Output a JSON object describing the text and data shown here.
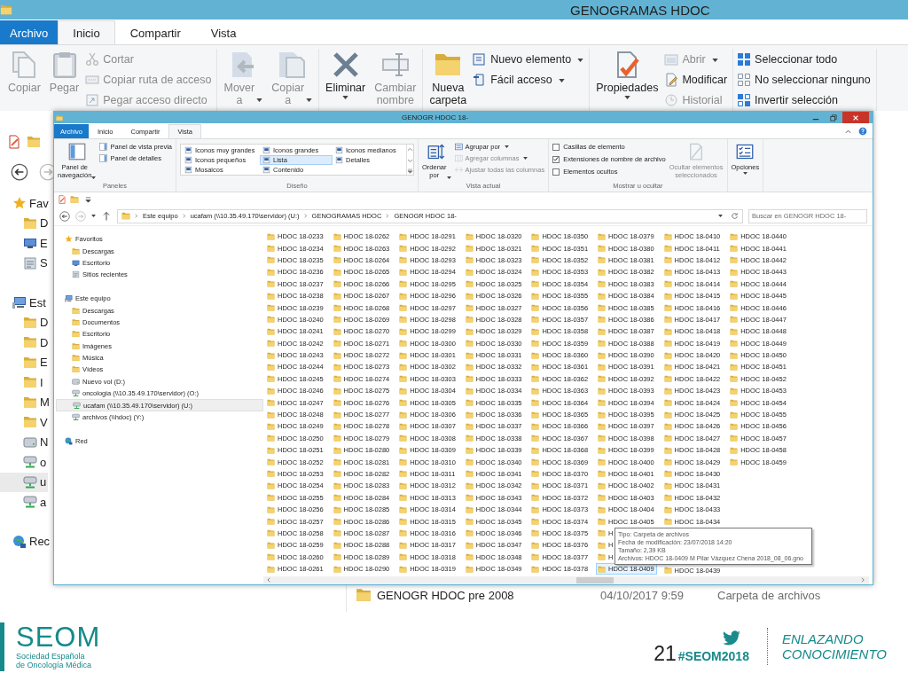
{
  "back_window": {
    "title": "GENOGRAMAS HDOC",
    "tabs": [
      {
        "label": "Archivo",
        "kind": "file",
        "selected": false
      },
      {
        "label": "Inicio",
        "kind": "tab",
        "selected": true
      },
      {
        "label": "Compartir",
        "kind": "tab",
        "selected": false
      },
      {
        "label": "Vista",
        "kind": "tab",
        "selected": false
      }
    ],
    "ribbon": [
      {
        "items": [
          {
            "kind": "large",
            "label": "Copiar",
            "dropdown": false,
            "disabled": true
          },
          {
            "kind": "large",
            "label": "Pegar",
            "dropdown": false,
            "disabled": true
          },
          {
            "kind": "small",
            "label": "Cortar",
            "dropdown": false,
            "disabled": true
          },
          {
            "kind": "small",
            "label": "Copiar ruta de acceso",
            "dropdown": false,
            "disabled": true
          },
          {
            "kind": "small",
            "label": "Pegar acceso directo",
            "dropdown": false,
            "disabled": true
          }
        ]
      },
      {
        "items": [
          {
            "kind": "large",
            "label": "Mover\na",
            "dropdown": true,
            "disabled": true
          },
          {
            "kind": "large",
            "label": "Copiar\na",
            "dropdown": true,
            "disabled": true
          }
        ]
      },
      {
        "items": [
          {
            "kind": "large",
            "label": "Eliminar",
            "dropdown": true,
            "disabled": false
          },
          {
            "kind": "large",
            "label": "Cambiar\nnombre",
            "dropdown": false,
            "disabled": true
          }
        ]
      },
      {
        "items": [
          {
            "kind": "large",
            "label": "Nueva\ncarpeta",
            "dropdown": false,
            "disabled": false
          },
          {
            "kind": "small",
            "label": "Nuevo elemento",
            "dropdown": true,
            "disabled": false
          },
          {
            "kind": "small",
            "label": "Fácil acceso",
            "dropdown": true,
            "disabled": false
          }
        ]
      },
      {
        "items": [
          {
            "kind": "large",
            "label": "Propiedades",
            "dropdown": true,
            "disabled": false
          },
          {
            "kind": "small",
            "label": "Abrir",
            "dropdown": true,
            "disabled": true
          },
          {
            "kind": "small",
            "label": "Modificar",
            "dropdown": false,
            "disabled": false
          },
          {
            "kind": "small",
            "label": "Historial",
            "dropdown": false,
            "disabled": true
          }
        ]
      },
      {
        "items": [
          {
            "kind": "small",
            "label": "Seleccionar todo",
            "dropdown": false,
            "disabled": false
          },
          {
            "kind": "small",
            "label": "No seleccionar ninguno",
            "dropdown": false,
            "disabled": false
          },
          {
            "kind": "small",
            "label": "Invertir selección",
            "dropdown": false,
            "disabled": false
          }
        ]
      }
    ],
    "nav": [
      {
        "label": "Fav",
        "selected": false,
        "children": [
          {
            "label": "D",
            "selected": false
          },
          {
            "label": "E",
            "selected": false
          },
          {
            "label": "S",
            "selected": false
          }
        ]
      },
      {
        "label": "Est",
        "selected": false,
        "children": [
          {
            "label": "D",
            "selected": false
          },
          {
            "label": "D",
            "selected": false
          },
          {
            "label": "E",
            "selected": false
          },
          {
            "label": "I",
            "selected": false
          },
          {
            "label": "M",
            "selected": false
          },
          {
            "label": "V",
            "selected": false
          },
          {
            "label": "N",
            "selected": false
          },
          {
            "label": "o",
            "selected": false
          },
          {
            "label": "u",
            "selected": true
          },
          {
            "label": "a",
            "selected": false
          }
        ]
      },
      {
        "label": "Rec",
        "selected": false
      }
    ],
    "file_row": {
      "name": "GENOGR HDOC pre 2008",
      "date": "04/10/2017 9:59",
      "type": "Carpeta de archivos"
    }
  },
  "front_window": {
    "title": "GENOGR HDOC 18-",
    "tabs": [
      {
        "label": "Archivo",
        "kind": "file",
        "selected": false
      },
      {
        "label": "Inicio",
        "kind": "tab",
        "selected": false
      },
      {
        "label": "Compartir",
        "kind": "tab",
        "selected": false
      },
      {
        "label": "Vista",
        "kind": "tab",
        "selected": true
      }
    ],
    "ribbon": [
      {
        "label": "Paneles",
        "items": [
          {
            "kind": "large",
            "label": "Panel de\nnavegación",
            "dropdown": true,
            "disabled": false
          },
          {
            "kind": "small",
            "label": "Panel de vista previa",
            "dropdown": false,
            "disabled": false
          },
          {
            "kind": "small",
            "label": "Panel de detalles",
            "dropdown": false,
            "disabled": false
          }
        ]
      },
      {
        "label": "Diseño",
        "items": [
          {
            "kind": "layout",
            "label": "Iconos muy grandes",
            "selected": false
          },
          {
            "kind": "layout",
            "label": "Iconos grandes",
            "selected": false
          },
          {
            "kind": "layout",
            "label": "Iconos medianos",
            "selected": false
          },
          {
            "kind": "layout",
            "label": "Iconos pequeños",
            "selected": false
          },
          {
            "kind": "layout",
            "label": "Lista",
            "selected": true
          },
          {
            "kind": "layout",
            "label": "Detalles",
            "selected": false
          },
          {
            "kind": "layout",
            "label": "Mosaicos",
            "selected": false
          },
          {
            "kind": "layout",
            "label": "Contenido",
            "selected": false
          }
        ]
      },
      {
        "label": "Vista actual",
        "items": [
          {
            "kind": "large",
            "label": "Ordenar\npor",
            "dropdown": true,
            "disabled": false
          },
          {
            "kind": "small",
            "label": "Agrupar por",
            "dropdown": true,
            "disabled": false
          },
          {
            "kind": "small",
            "label": "Agregar columnas",
            "dropdown": true,
            "disabled": true
          },
          {
            "kind": "small",
            "label": "Ajustar todas las columnas",
            "dropdown": false,
            "disabled": true
          }
        ]
      },
      {
        "label": "Mostrar u ocultar",
        "items": [
          {
            "kind": "check",
            "label": "Casillas de elemento",
            "checked": false
          },
          {
            "kind": "check",
            "label": "Extensiones de nombre de archivo",
            "checked": true
          },
          {
            "kind": "check",
            "label": "Elementos ocultos",
            "checked": false
          },
          {
            "kind": "large",
            "label": "Ocultar elementos\nseleccionados",
            "dropdown": false,
            "disabled": true
          }
        ]
      },
      {
        "items": [
          {
            "kind": "large",
            "label": "Opciones",
            "dropdown": true,
            "disabled": false
          }
        ]
      }
    ],
    "address": {
      "path": [
        "Este equipo",
        "ucafam (\\\\10.35.49.170\\servidor) (U:)",
        "GENOGRAMAS HDOC",
        "GENOGR HDOC 18-"
      ],
      "search_placeholder": "Buscar en GENOGR HDOC 18-"
    },
    "nav": [
      {
        "label": "Favoritos",
        "selected": false,
        "children": [
          {
            "label": "Descargas",
            "selected": false
          },
          {
            "label": "Escritorio",
            "selected": false
          },
          {
            "label": "Sitios recientes",
            "selected": false
          }
        ]
      },
      {
        "label": "Este equipo",
        "selected": false,
        "children": [
          {
            "label": "Descargas",
            "selected": false
          },
          {
            "label": "Documentos",
            "selected": false
          },
          {
            "label": "Escritorio",
            "selected": false
          },
          {
            "label": "Imágenes",
            "selected": false
          },
          {
            "label": "Música",
            "selected": false
          },
          {
            "label": "Vídeos",
            "selected": false
          },
          {
            "label": "Nuevo vol (D:)",
            "selected": false
          },
          {
            "label": "oncologia (\\\\10.35.49.170\\servidor) (O:)",
            "selected": false
          },
          {
            "label": "ucafam (\\\\10.35.49.170\\servidor) (U:)",
            "selected": true
          },
          {
            "label": "archivos (\\\\hdoc) (Y:)",
            "selected": false
          }
        ]
      },
      {
        "label": "Red",
        "selected": false
      }
    ],
    "files": {
      "columns": [
        {
          "items": [
            {
              "name": "HDOC 18-0233",
              "selected": false
            },
            {
              "name": "HDOC 18-0234",
              "selected": false
            },
            {
              "name": "HDOC 18-0235",
              "selected": false
            },
            {
              "name": "HDOC 18-0236",
              "selected": false
            },
            {
              "name": "HDOC 18-0237",
              "selected": false
            },
            {
              "name": "HDOC 18-0238",
              "selected": false
            },
            {
              "name": "HDOC 18-0239",
              "selected": false
            },
            {
              "name": "HDOC 18-0240",
              "selected": false
            },
            {
              "name": "HDOC 18-0241",
              "selected": false
            },
            {
              "name": "HDOC 18-0242",
              "selected": false
            },
            {
              "name": "HDOC 18-0243",
              "selected": false
            },
            {
              "name": "HDOC 18-0244",
              "selected": false
            },
            {
              "name": "HDOC 18-0245",
              "selected": false
            },
            {
              "name": "HDOC 18-0246",
              "selected": false
            },
            {
              "name": "HDOC 18-0247",
              "selected": false
            },
            {
              "name": "HDOC 18-0248",
              "selected": false
            },
            {
              "name": "HDOC 18-0249",
              "selected": false
            },
            {
              "name": "HDOC 18-0250",
              "selected": false
            },
            {
              "name": "HDOC 18-0251",
              "selected": false
            },
            {
              "name": "HDOC 18-0252",
              "selected": false
            },
            {
              "name": "HDOC 18-0253",
              "selected": false
            },
            {
              "name": "HDOC 18-0254",
              "selected": false
            },
            {
              "name": "HDOC 18-0255",
              "selected": false
            },
            {
              "name": "HDOC 18-0256",
              "selected": false
            },
            {
              "name": "HDOC 18-0257",
              "selected": false
            },
            {
              "name": "HDOC 18-0258",
              "selected": false
            },
            {
              "name": "HDOC 18-0259",
              "selected": false
            },
            {
              "name": "HDOC 18-0260",
              "selected": false
            },
            {
              "name": "HDOC 18-0261",
              "selected": false
            }
          ]
        },
        {
          "items": [
            {
              "name": "HDOC 18-0262",
              "selected": false
            },
            {
              "name": "HDOC 18-0263",
              "selected": false
            },
            {
              "name": "HDOC 18-0264",
              "selected": false
            },
            {
              "name": "HDOC 18-0265",
              "selected": false
            },
            {
              "name": "HDOC 18-0266",
              "selected": false
            },
            {
              "name": "HDOC 18-0267",
              "selected": false
            },
            {
              "name": "HDOC 18-0268",
              "selected": false
            },
            {
              "name": "HDOC 18-0269",
              "selected": false
            },
            {
              "name": "HDOC 18-0270",
              "selected": false
            },
            {
              "name": "HDOC 18-0271",
              "selected": false
            },
            {
              "name": "HDOC 18-0272",
              "selected": false
            },
            {
              "name": "HDOC 18-0273",
              "selected": false
            },
            {
              "name": "HDOC 18-0274",
              "selected": false
            },
            {
              "name": "HDOC 18-0275",
              "selected": false
            },
            {
              "name": "HDOC 18-0276",
              "selected": false
            },
            {
              "name": "HDOC 18-0277",
              "selected": false
            },
            {
              "name": "HDOC 18-0278",
              "selected": false
            },
            {
              "name": "HDOC 18-0279",
              "selected": false
            },
            {
              "name": "HDOC 18-0280",
              "selected": false
            },
            {
              "name": "HDOC 18-0281",
              "selected": false
            },
            {
              "name": "HDOC 18-0282",
              "selected": false
            },
            {
              "name": "HDOC 18-0283",
              "selected": false
            },
            {
              "name": "HDOC 18-0284",
              "selected": false
            },
            {
              "name": "HDOC 18-0285",
              "selected": false
            },
            {
              "name": "HDOC 18-0286",
              "selected": false
            },
            {
              "name": "HDOC 18-0287",
              "selected": false
            },
            {
              "name": "HDOC 18-0288",
              "selected": false
            },
            {
              "name": "HDOC 18-0289",
              "selected": false
            },
            {
              "name": "HDOC 18-0290",
              "selected": false
            }
          ]
        },
        {
          "items": [
            {
              "name": "HDOC 18-0291",
              "selected": false
            },
            {
              "name": "HDOC 18-0292",
              "selected": false
            },
            {
              "name": "HDOC 18-0293",
              "selected": false
            },
            {
              "name": "HDOC 18-0294",
              "selected": false
            },
            {
              "name": "HDOC 18-0295",
              "selected": false
            },
            {
              "name": "HDOC 18-0296",
              "selected": false
            },
            {
              "name": "HDOC 18-0297",
              "selected": false
            },
            {
              "name": "HDOC 18-0298",
              "selected": false
            },
            {
              "name": "HDOC 18-0299",
              "selected": false
            },
            {
              "name": "HDOC 18-0300",
              "selected": false
            },
            {
              "name": "HDOC 18-0301",
              "selected": false
            },
            {
              "name": "HDOC 18-0302",
              "selected": false
            },
            {
              "name": "HDOC 18-0303",
              "selected": false
            },
            {
              "name": "HDOC 18-0304",
              "selected": false
            },
            {
              "name": "HDOC 18-0305",
              "selected": false
            },
            {
              "name": "HDOC 18-0306",
              "selected": false
            },
            {
              "name": "HDOC 18-0307",
              "selected": false
            },
            {
              "name": "HDOC 18-0308",
              "selected": false
            },
            {
              "name": "HDOC 18-0309",
              "selected": false
            },
            {
              "name": "HDOC 18-0310",
              "selected": false
            },
            {
              "name": "HDOC 18-0311",
              "selected": false
            },
            {
              "name": "HDOC 18-0312",
              "selected": false
            },
            {
              "name": "HDOC 18-0313",
              "selected": false
            },
            {
              "name": "HDOC 18-0314",
              "selected": false
            },
            {
              "name": "HDOC 18-0315",
              "selected": false
            },
            {
              "name": "HDOC 18-0316",
              "selected": false
            },
            {
              "name": "HDOC 18-0317",
              "selected": false
            },
            {
              "name": "HDOC 18-0318",
              "selected": false
            },
            {
              "name": "HDOC 18-0319",
              "selected": false
            }
          ]
        },
        {
          "items": [
            {
              "name": "HDOC 18-0320",
              "selected": false
            },
            {
              "name": "HDOC 18-0321",
              "selected": false
            },
            {
              "name": "HDOC 18-0323",
              "selected": false
            },
            {
              "name": "HDOC 18-0324",
              "selected": false
            },
            {
              "name": "HDOC 18-0325",
              "selected": false
            },
            {
              "name": "HDOC 18-0326",
              "selected": false
            },
            {
              "name": "HDOC 18-0327",
              "selected": false
            },
            {
              "name": "HDOC 18-0328",
              "selected": false
            },
            {
              "name": "HDOC 18-0329",
              "selected": false
            },
            {
              "name": "HDOC 18-0330",
              "selected": false
            },
            {
              "name": "HDOC 18-0331",
              "selected": false
            },
            {
              "name": "HDOC 18-0332",
              "selected": false
            },
            {
              "name": "HDOC 18-0333",
              "selected": false
            },
            {
              "name": "HDOC 18-0334",
              "selected": false
            },
            {
              "name": "HDOC 18-0335",
              "selected": false
            },
            {
              "name": "HDOC 18-0336",
              "selected": false
            },
            {
              "name": "HDOC 18-0337",
              "selected": false
            },
            {
              "name": "HDOC 18-0338",
              "selected": false
            },
            {
              "name": "HDOC 18-0339",
              "selected": false
            },
            {
              "name": "HDOC 18-0340",
              "selected": false
            },
            {
              "name": "HDOC 18-0341",
              "selected": false
            },
            {
              "name": "HDOC 18-0342",
              "selected": false
            },
            {
              "name": "HDOC 18-0343",
              "selected": false
            },
            {
              "name": "HDOC 18-0344",
              "selected": false
            },
            {
              "name": "HDOC 18-0345",
              "selected": false
            },
            {
              "name": "HDOC 18-0346",
              "selected": false
            },
            {
              "name": "HDOC 18-0347",
              "selected": false
            },
            {
              "name": "HDOC 18-0348",
              "selected": false
            },
            {
              "name": "HDOC 18-0349",
              "selected": false
            }
          ]
        },
        {
          "items": [
            {
              "name": "HDOC 18-0350",
              "selected": false
            },
            {
              "name": "HDOC 18-0351",
              "selected": false
            },
            {
              "name": "HDOC 18-0352",
              "selected": false
            },
            {
              "name": "HDOC 18-0353",
              "selected": false
            },
            {
              "name": "HDOC 18-0354",
              "selected": false
            },
            {
              "name": "HDOC 18-0355",
              "selected": false
            },
            {
              "name": "HDOC 18-0356",
              "selected": false
            },
            {
              "name": "HDOC 18-0357",
              "selected": false
            },
            {
              "name": "HDOC 18-0358",
              "selected": false
            },
            {
              "name": "HDOC 18-0359",
              "selected": false
            },
            {
              "name": "HDOC 18-0360",
              "selected": false
            },
            {
              "name": "HDOC 18-0361",
              "selected": false
            },
            {
              "name": "HDOC 18-0362",
              "selected": false
            },
            {
              "name": "HDOC 18-0363",
              "selected": false
            },
            {
              "name": "HDOC 18-0364",
              "selected": false
            },
            {
              "name": "HDOC 18-0365",
              "selected": false
            },
            {
              "name": "HDOC 18-0366",
              "selected": false
            },
            {
              "name": "HDOC 18-0367",
              "selected": false
            },
            {
              "name": "HDOC 18-0368",
              "selected": false
            },
            {
              "name": "HDOC 18-0369",
              "selected": false
            },
            {
              "name": "HDOC 18-0370",
              "selected": false
            },
            {
              "name": "HDOC 18-0371",
              "selected": false
            },
            {
              "name": "HDOC 18-0372",
              "selected": false
            },
            {
              "name": "HDOC 18-0373",
              "selected": false
            },
            {
              "name": "HDOC 18-0374",
              "selected": false
            },
            {
              "name": "HDOC 18-0375",
              "selected": false
            },
            {
              "name": "HDOC 18-0376",
              "selected": false
            },
            {
              "name": "HDOC 18-0377",
              "selected": false
            },
            {
              "name": "HDOC 18-0378",
              "selected": false
            }
          ]
        },
        {
          "items": [
            {
              "name": "HDOC 18-0379",
              "selected": false
            },
            {
              "name": "HDOC 18-0380",
              "selected": false
            },
            {
              "name": "HDOC 18-0381",
              "selected": false
            },
            {
              "name": "HDOC 18-0382",
              "selected": false
            },
            {
              "name": "HDOC 18-0383",
              "selected": false
            },
            {
              "name": "HDOC 18-0384",
              "selected": false
            },
            {
              "name": "HDOC 18-0385",
              "selected": false
            },
            {
              "name": "HDOC 18-0386",
              "selected": false
            },
            {
              "name": "HDOC 18-0387",
              "selected": false
            },
            {
              "name": "HDOC 18-0388",
              "selected": false
            },
            {
              "name": "HDOC 18-0390",
              "selected": false
            },
            {
              "name": "HDOC 18-0391",
              "selected": false
            },
            {
              "name": "HDOC 18-0392",
              "selected": false
            },
            {
              "name": "HDOC 18-0393",
              "selected": false
            },
            {
              "name": "HDOC 18-0394",
              "selected": false
            },
            {
              "name": "HDOC 18-0395",
              "selected": false
            },
            {
              "name": "HDOC 18-0397",
              "selected": false
            },
            {
              "name": "HDOC 18-0398",
              "selected": false
            },
            {
              "name": "HDOC 18-0399",
              "selected": false
            },
            {
              "name": "HDOC 18-0400",
              "selected": false
            },
            {
              "name": "HDOC 18-0401",
              "selected": false
            },
            {
              "name": "HDOC 18-0402",
              "selected": false
            },
            {
              "name": "HDOC 18-0403",
              "selected": false
            },
            {
              "name": "HDOC 18-0404",
              "selected": false
            },
            {
              "name": "HDOC 18-0405",
              "selected": false
            },
            {
              "name": "H",
              "selected": false
            },
            {
              "name": "H",
              "selected": false
            },
            {
              "name": "H",
              "selected": false
            },
            {
              "name": "HDOC 18-0409",
              "selected": true
            }
          ]
        },
        {
          "items": [
            {
              "name": "HDOC 18-0410",
              "selected": false
            },
            {
              "name": "HDOC 18-0411",
              "selected": false
            },
            {
              "name": "HDOC 18-0412",
              "selected": false
            },
            {
              "name": "HDOC 18-0413",
              "selected": false
            },
            {
              "name": "HDOC 18-0414",
              "selected": false
            },
            {
              "name": "HDOC 18-0415",
              "selected": false
            },
            {
              "name": "HDOC 18-0416",
              "selected": false
            },
            {
              "name": "HDOC 18-0417",
              "selected": false
            },
            {
              "name": "HDOC 18-0418",
              "selected": false
            },
            {
              "name": "HDOC 18-0419",
              "selected": false
            },
            {
              "name": "HDOC 18-0420",
              "selected": false
            },
            {
              "name": "HDOC 18-0421",
              "selected": false
            },
            {
              "name": "HDOC 18-0422",
              "selected": false
            },
            {
              "name": "HDOC 18-0423",
              "selected": false
            },
            {
              "name": "HDOC 18-0424",
              "selected": false
            },
            {
              "name": "HDOC 18-0425",
              "selected": false
            },
            {
              "name": "HDOC 18-0426",
              "selected": false
            },
            {
              "name": "HDOC 18-0427",
              "selected": false
            },
            {
              "name": "HDOC 18-0428",
              "selected": false
            },
            {
              "name": "HDOC 18-0429",
              "selected": false
            },
            {
              "name": "HDOC 18-0430",
              "selected": false
            },
            {
              "name": "HDOC 18-0431",
              "selected": false
            },
            {
              "name": "HDOC 18-0432",
              "selected": false
            },
            {
              "name": "HDOC 18-0433",
              "selected": false
            },
            {
              "name": "HDOC 18-0434",
              "selected": false
            }
          ],
          "items_below_tooltip": [
            {
              "name": "HDOC 18-0439",
              "selected": false
            }
          ]
        },
        {
          "items": [
            {
              "name": "HDOC 18-0440",
              "selected": false
            },
            {
              "name": "HDOC 18-0441",
              "selected": false
            },
            {
              "name": "HDOC 18-0442",
              "selected": false
            },
            {
              "name": "HDOC 18-0443",
              "selected": false
            },
            {
              "name": "HDOC 18-0444",
              "selected": false
            },
            {
              "name": "HDOC 18-0445",
              "selected": false
            },
            {
              "name": "HDOC 18-0446",
              "selected": false
            },
            {
              "name": "HDOC 18-0447",
              "selected": false
            },
            {
              "name": "HDOC 18-0448",
              "selected": false
            },
            {
              "name": "HDOC 18-0449",
              "selected": false
            },
            {
              "name": "HDOC 18-0450",
              "selected": false
            },
            {
              "name": "HDOC 18-0451",
              "selected": false
            },
            {
              "name": "HDOC 18-0452",
              "selected": false
            },
            {
              "name": "HDOC 18-0453",
              "selected": false
            },
            {
              "name": "HDOC 18-0454",
              "selected": false
            },
            {
              "name": "HDOC 18-0455",
              "selected": false
            },
            {
              "name": "HDOC 18-0456",
              "selected": false
            },
            {
              "name": "HDOC 18-0457",
              "selected": false
            },
            {
              "name": "HDOC 18-0458",
              "selected": false
            },
            {
              "name": "HDOC 18-0459",
              "selected": false
            }
          ]
        }
      ],
      "tooltip": [
        "Tipo: Carpeta de archivos",
        "Fecha de modificación: 23/07/2018 14:20",
        "Tamaño: 2,39 KB",
        "Archivos: HDOC 18-0409 M Pilar Vázquez Chena 2018_08_06.gno"
      ]
    }
  },
  "footer": {
    "logo": "SEOM",
    "society": [
      "Sociedad Española",
      "de Oncología Médica"
    ],
    "page_number": "21",
    "hashtag": "#SEOM2018",
    "motto": [
      "ENLAZANDO",
      "CONOCIMIENTO"
    ]
  }
}
